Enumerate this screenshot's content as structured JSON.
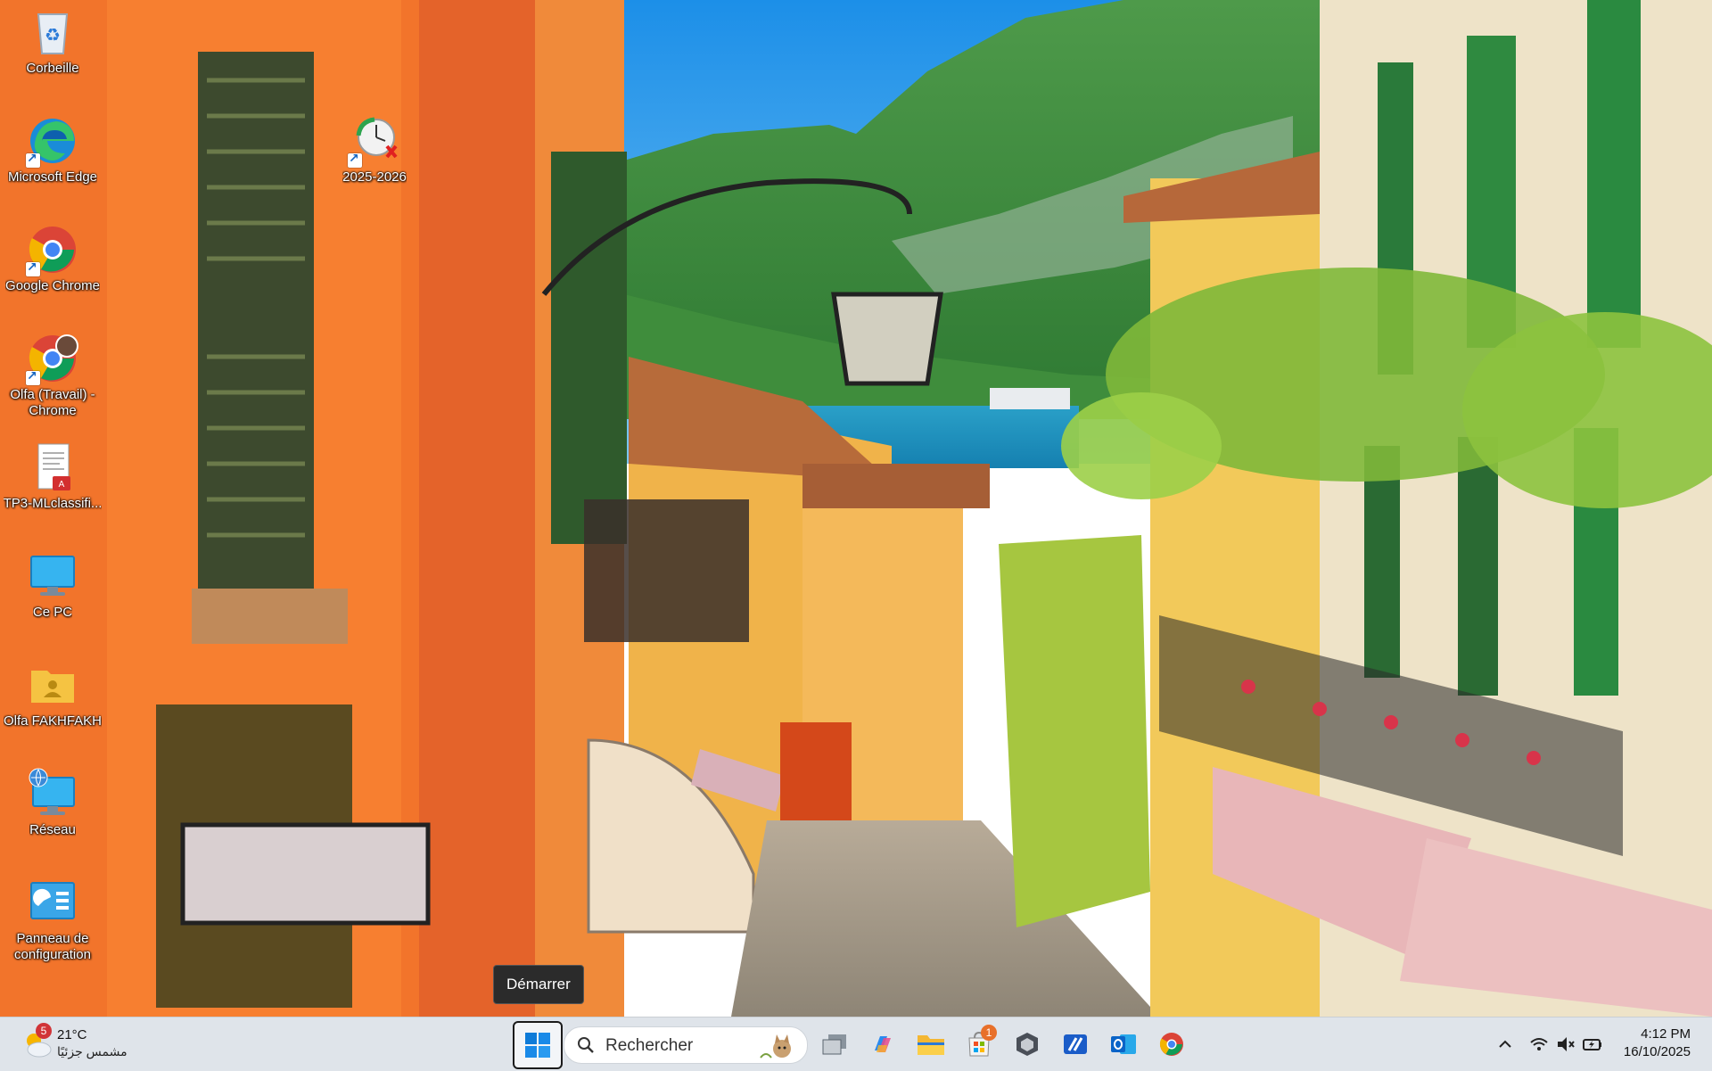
{
  "desktop": {
    "icons": [
      {
        "label": "Corbeille"
      },
      {
        "label": "Microsoft Edge"
      },
      {
        "label": "Google Chrome"
      },
      {
        "label": "Olfa (Travail) - Chrome"
      },
      {
        "label": "TP3-MLclassifi..."
      },
      {
        "label": "Ce PC"
      },
      {
        "label": "Olfa FAKHFAKH"
      },
      {
        "label": "Réseau"
      },
      {
        "label": "Panneau de configuration"
      },
      {
        "label": "2025-2026"
      }
    ]
  },
  "tooltip": {
    "text": "Démarrer"
  },
  "taskbar": {
    "weather": {
      "temp": "21°C",
      "condition": "مشمس جزئيًا",
      "badge": "5"
    },
    "search": {
      "placeholder": "Rechercher"
    },
    "store_badge": "1",
    "pinned": [
      "task-view",
      "copilot",
      "file-explorer",
      "microsoft-store",
      "app-cube",
      "app-stylus",
      "outlook",
      "chrome"
    ],
    "clock": {
      "time": "4:12 PM",
      "date": "16/10/2025"
    }
  },
  "colors": {
    "taskbar_bg": "#dfe4ea",
    "accent": "#0067c0",
    "badge_red": "#d13438",
    "badge_orange": "#e8702a"
  }
}
